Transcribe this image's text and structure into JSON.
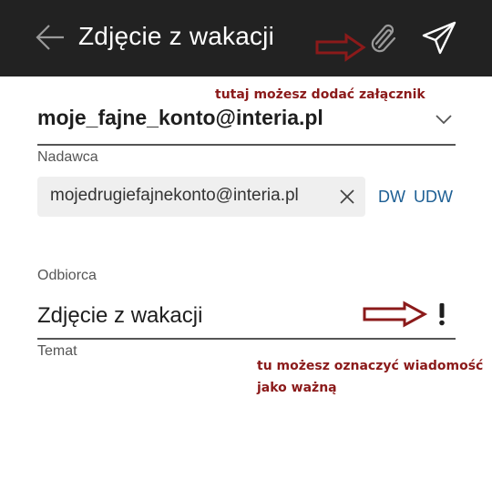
{
  "header": {
    "title": "Zdjęcie z wakacji",
    "icons": [
      "back-arrow",
      "paperclip",
      "send-paper-plane"
    ]
  },
  "annotations": {
    "attachment_note": "tutaj możesz dodać załącznik",
    "importance_note_line1": "tu możesz oznaczyć wiadomość",
    "importance_note_line2": "jako ważną",
    "color": "#8b1a1a"
  },
  "sender": {
    "account": "moje_fajne_konto@interia.pl",
    "label": "Nadawca"
  },
  "recipient": {
    "chip": "mojedrugiefajnekonto@interia.pl",
    "cc_label": "DW",
    "bcc_label": "UDW",
    "label": "Odbiorca"
  },
  "subject": {
    "value": "Zdjęcie z wakacji",
    "label": "Temat",
    "importance_symbol": "!"
  },
  "colors": {
    "topbar": "#222222",
    "link": "#1d5f94",
    "annotation": "#8b1a1a"
  }
}
